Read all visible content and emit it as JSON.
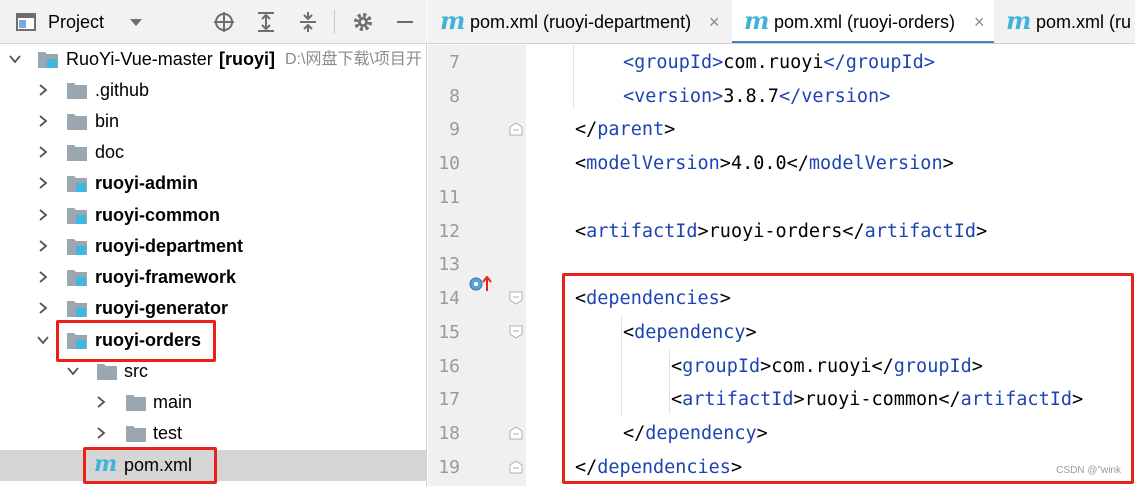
{
  "project_panel": {
    "title": "Project",
    "tree": [
      {
        "label": "RuoYi-Vue-master",
        "module": "[ruoyi]",
        "path": "D:\\网盘下载\\项目开",
        "expanded": true
      },
      {
        "label": ".github"
      },
      {
        "label": "bin"
      },
      {
        "label": "doc"
      },
      {
        "label": "ruoyi-admin"
      },
      {
        "label": "ruoyi-common"
      },
      {
        "label": "ruoyi-department"
      },
      {
        "label": "ruoyi-framework"
      },
      {
        "label": "ruoyi-generator"
      },
      {
        "label": "ruoyi-orders",
        "expanded": true,
        "highlighted": true
      },
      {
        "label": "src",
        "expanded": true
      },
      {
        "label": "main"
      },
      {
        "label": "test"
      },
      {
        "label": "pom.xml",
        "selected": true,
        "highlighted": true
      }
    ]
  },
  "editor": {
    "tabs": [
      {
        "label": "pom.xml (ruoyi-department)",
        "active": false
      },
      {
        "label": "pom.xml (ruoyi-orders)",
        "active": true
      },
      {
        "label": "pom.xml (ru",
        "active": false
      }
    ],
    "close_glyph": "×",
    "file_icon_letter": "m",
    "lines": [
      {
        "num": "7",
        "open": "groupId",
        "text": "com.ruoyi",
        "close": "groupId"
      },
      {
        "num": "8",
        "open": "version",
        "text": "3.8.7",
        "close": "version"
      },
      {
        "num": "9",
        "close_only": "parent"
      },
      {
        "num": "10",
        "open": "modelVersion",
        "text": "4.0.0",
        "close": "modelVersion"
      },
      {
        "num": "11"
      },
      {
        "num": "12",
        "open": "artifactId",
        "text": "ruoyi-orders",
        "close": "artifactId"
      },
      {
        "num": "13"
      },
      {
        "num": "14",
        "open_only": "dependencies"
      },
      {
        "num": "15",
        "open_only": "dependency"
      },
      {
        "num": "16",
        "open": "groupId",
        "text": "com.ruoyi",
        "close": "groupId"
      },
      {
        "num": "17",
        "open": "artifactId",
        "text": "ruoyi-common",
        "close": "artifactId"
      },
      {
        "num": "18",
        "close_only": "dependency"
      },
      {
        "num": "19",
        "close_only": "dependencies"
      }
    ]
  },
  "watermark": "CSDN @\"wink",
  "colors": {
    "tag": "#1e44b4",
    "highlight": "#e8221b",
    "maven_icon": "#3fb3da",
    "active_tab_underline": "#4083c9"
  }
}
